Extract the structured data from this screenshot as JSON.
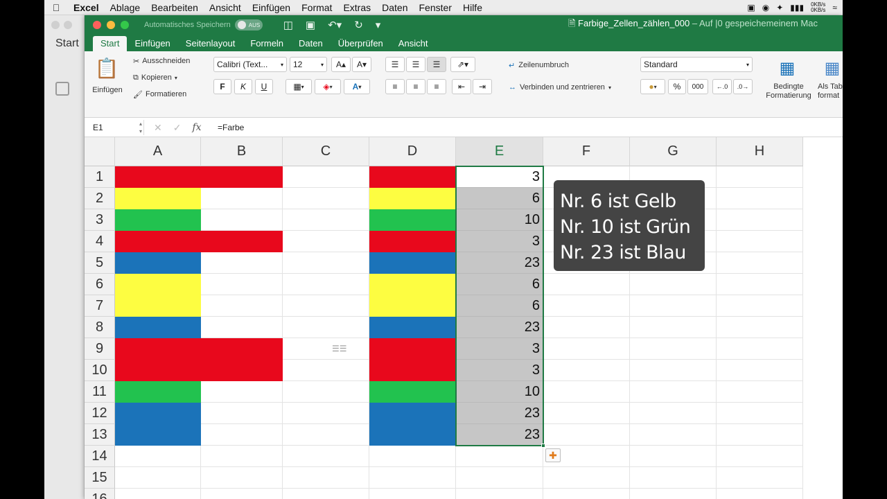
{
  "menubar": {
    "app": "Excel",
    "items": [
      "Ablage",
      "Bearbeiten",
      "Ansicht",
      "Einfügen",
      "Format",
      "Extras",
      "Daten",
      "Fenster",
      "Hilfe"
    ],
    "speed_up": "0KB/s",
    "speed_down": "0KB/s"
  },
  "background_window": {
    "label": "Start"
  },
  "titlebar": {
    "autosave_label": "Automatisches Speichern",
    "autosave_state": "AUS",
    "doc_name": "Farbige_Zellen_zählen_000",
    "doc_status": " – Auf |0 gespeichemeinem Mac"
  },
  "tabs": [
    "Start",
    "Einfügen",
    "Seitenlayout",
    "Formeln",
    "Daten",
    "Überprüfen",
    "Ansicht"
  ],
  "ribbon": {
    "paste_label": "Einfügen",
    "cut_label": "Ausschneiden",
    "copy_label": "Kopieren",
    "format_painter_label": "Formatieren",
    "font_name": "Calibri (Text...",
    "font_size": "12",
    "bold": "F",
    "italic": "K",
    "underline": "U",
    "wrap_text": "Zeilenumbruch",
    "merge_center": "Verbinden und zentrieren",
    "number_format": "Standard",
    "percent": "%",
    "thousands": "000",
    "cond_format_1": "Bedingte",
    "cond_format_2": "Formatierung",
    "as_table_1": "Als Tab",
    "as_table_2": "format"
  },
  "formula_bar": {
    "name_box": "E1",
    "formula": "=Farbe",
    "fx": "fx"
  },
  "columns": [
    "A",
    "B",
    "C",
    "D",
    "E",
    "F",
    "G",
    "H"
  ],
  "rows": [
    "1",
    "2",
    "3",
    "4",
    "5",
    "6",
    "7",
    "8",
    "9",
    "10",
    "11",
    "12",
    "13",
    "14",
    "15",
    "16"
  ],
  "colors": {
    "red": "#e8081c",
    "yellow": "#fdfd41",
    "green": "#22c24f",
    "blue": "#1b73b9",
    "excel_green": "#1f7a44"
  },
  "cells": {
    "A": [
      "red",
      "yellow",
      "green",
      "red",
      "blue",
      "yellow",
      "yellow",
      "blue",
      "red",
      "red",
      "green",
      "blue",
      "blue"
    ],
    "B": [
      "red",
      "",
      "",
      "red",
      "",
      "",
      "",
      "",
      "red",
      "red",
      "",
      "",
      ""
    ],
    "D": [
      "red",
      "yellow",
      "green",
      "red",
      "blue",
      "yellow",
      "yellow",
      "blue",
      "red",
      "red",
      "green",
      "blue",
      "blue"
    ],
    "E": [
      "3",
      "6",
      "10",
      "3",
      "23",
      "6",
      "6",
      "23",
      "3",
      "3",
      "10",
      "23",
      "23"
    ]
  },
  "callout": [
    "Nr. 6 ist Gelb",
    "Nr. 10 ist Grün",
    "Nr. 23 ist Blau"
  ]
}
